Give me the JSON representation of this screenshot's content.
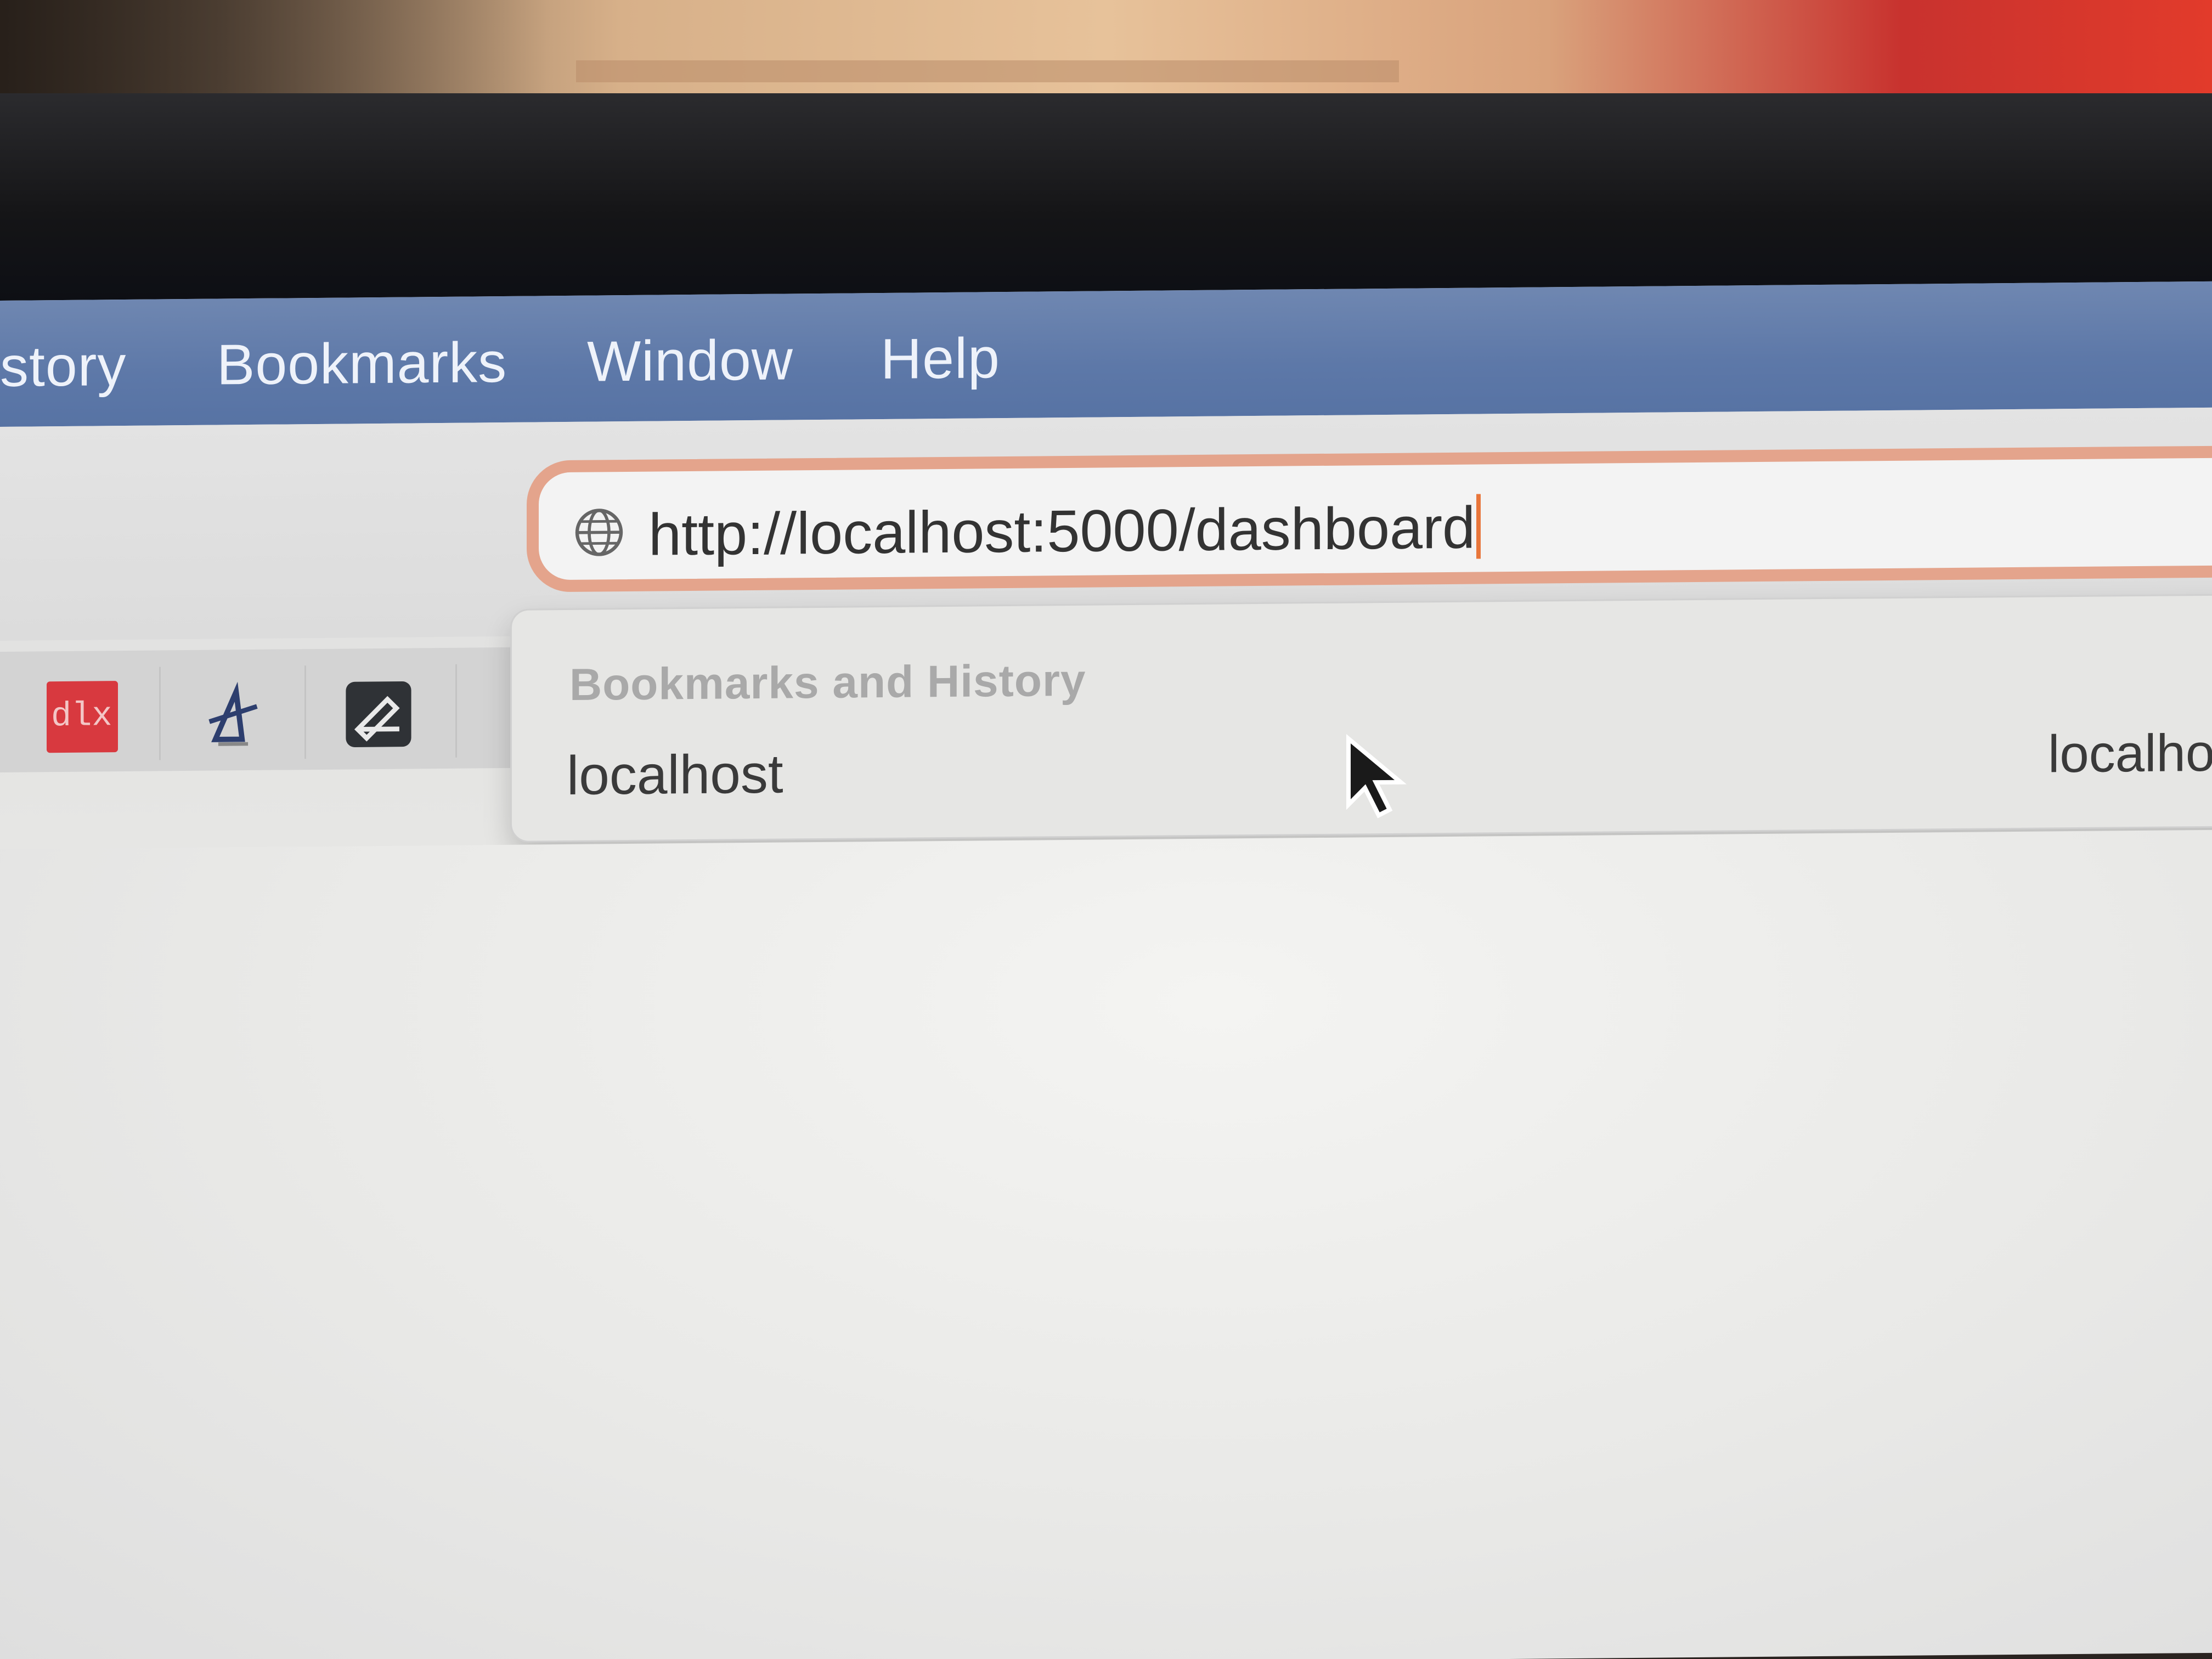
{
  "menubar": {
    "items": [
      "story",
      "Bookmarks",
      "Window",
      "Help"
    ]
  },
  "address_bar": {
    "value": "http://localhost:5000/dashboard",
    "icon": "globe-icon"
  },
  "bookmarks_bar": {
    "items": [
      {
        "name": "dlx-bookmark",
        "label": "dlx",
        "color": "#d8393f"
      },
      {
        "name": "triangle-logo-bookmark",
        "icon": "triangle-logo-icon"
      },
      {
        "name": "dark-square-bookmark",
        "icon": "pen-icon"
      }
    ]
  },
  "dropdown": {
    "heading": "Bookmarks and History",
    "suggestion": "localhost",
    "suggestion_right": "localho"
  },
  "colors": {
    "menubar": "#5d78a8",
    "focus_ring": "#e4a48c",
    "caret": "#e8763b"
  }
}
